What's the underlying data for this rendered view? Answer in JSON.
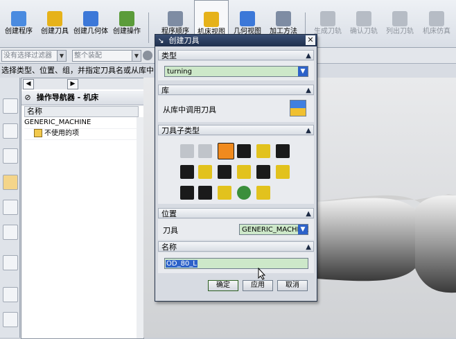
{
  "toolbar": {
    "groups_left": [
      {
        "label": "创建程序",
        "icon": "create-program-icon"
      },
      {
        "label": "创建刀具",
        "icon": "create-tool-icon"
      },
      {
        "label": "创建几何体",
        "icon": "create-geometry-icon"
      },
      {
        "label": "创建操作",
        "icon": "create-operation-icon"
      }
    ],
    "groups_mid": [
      {
        "label": "程序顺序",
        "icon": "program-order-icon"
      },
      {
        "label": "机床视图",
        "icon": "machine-view-icon"
      },
      {
        "label": "几何视图",
        "icon": "geometry-view-icon"
      },
      {
        "label": "加工方法",
        "icon": "machining-method-icon"
      }
    ],
    "groups_right": [
      {
        "label": "生成刀轨",
        "icon": "generate-path-icon"
      },
      {
        "label": "确认刀轨",
        "icon": "verify-path-icon"
      },
      {
        "label": "列出刀轨",
        "icon": "list-path-icon"
      },
      {
        "label": "机床仿真",
        "icon": "machine-sim-icon"
      }
    ]
  },
  "filters": {
    "selection_filter": "没有选择过滤器",
    "assembly": "整个装配"
  },
  "cue_line": "选择类型、位置、组，并指定刀具名或从库中",
  "navigator": {
    "title": "操作导航器 - 机床",
    "column_header": "名称",
    "rows": [
      {
        "label": "GENERIC_MACHINE"
      },
      {
        "label": "不使用的项"
      }
    ]
  },
  "dialog": {
    "title": "创建刀具",
    "section_type": "类型",
    "type_value": "turning",
    "section_library": "库",
    "library_label": "从库中调用刀具",
    "section_subtype": "刀具子类型",
    "section_location": "位置",
    "location_label": "刀具",
    "location_value": "GENERIC_MACHINE",
    "section_name": "名称",
    "name_value": "OD_80_L",
    "ok": "确定",
    "apply": "应用",
    "cancel": "取消"
  },
  "colors": {
    "title_bar": "#1f2f4d",
    "dropdown_fill": "#cde8c9",
    "selected_tool": "#f08a1e"
  }
}
